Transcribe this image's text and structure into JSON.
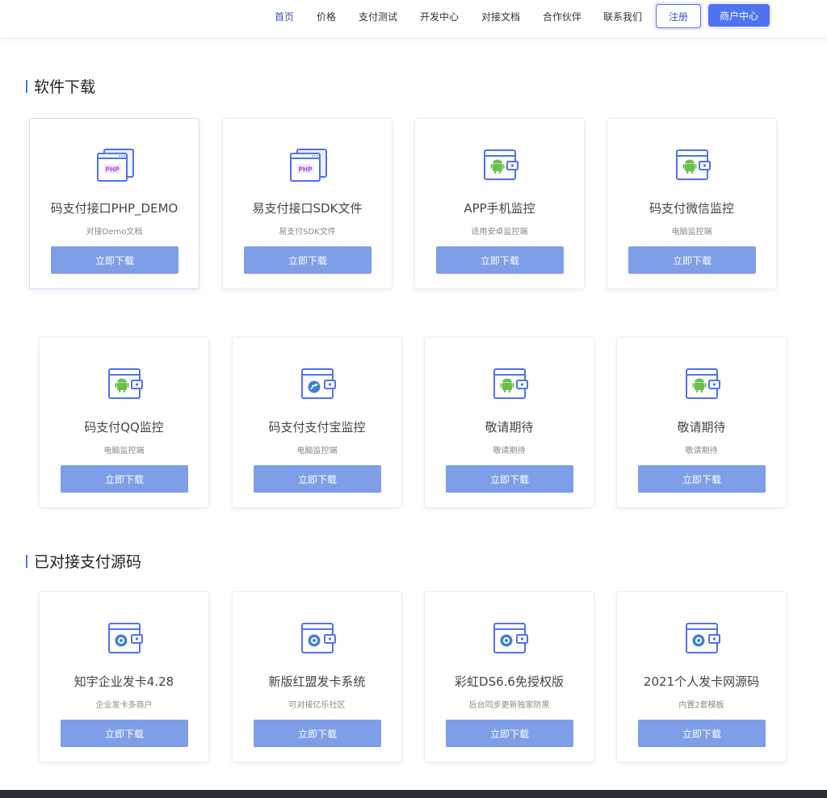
{
  "nav": {
    "items": [
      "首页",
      "价格",
      "支付测试",
      "开发中心",
      "对接文档",
      "合作伙伴",
      "联系我们"
    ],
    "register_label": "注册",
    "merchant_label": "商户中心"
  },
  "sections": [
    {
      "title": "软件下载",
      "cards": [
        {
          "title": "码支付接口PHP_DEMO",
          "subtitle": "对接Demo文档",
          "button": "立即下载",
          "icon": "php-icon"
        },
        {
          "title": "易支付接口SDK文件",
          "subtitle": "易支付SDK文件",
          "button": "立即下载",
          "icon": "php-icon"
        },
        {
          "title": "APP手机监控",
          "subtitle": "适用安卓监控端",
          "button": "立即下载",
          "icon": "android-icon"
        },
        {
          "title": "码支付微信监控",
          "subtitle": "电脑监控端",
          "button": "立即下载",
          "icon": "android-icon"
        },
        {
          "title": "码支付QQ监控",
          "subtitle": "电脑监控端",
          "button": "立即下载",
          "icon": "android-icon"
        },
        {
          "title": "码支付支付宝监控",
          "subtitle": "电脑监控端",
          "button": "立即下载",
          "icon": "alipay-icon"
        },
        {
          "title": "敬请期待",
          "subtitle": "敬请期待",
          "button": "立即下载",
          "icon": "android-icon"
        },
        {
          "title": "敬请期待",
          "subtitle": "敬请期待",
          "button": "立即下载",
          "icon": "android-icon"
        }
      ]
    },
    {
      "title": "已对接支付源码",
      "cards": [
        {
          "title": "知宇企业发卡4.28",
          "subtitle": "企业发卡多商户",
          "button": "立即下载",
          "icon": "gear-icon"
        },
        {
          "title": "新版红盟发卡系统",
          "subtitle": "可对接亿乐社区",
          "button": "立即下载",
          "icon": "gear-icon"
        },
        {
          "title": "彩虹DS6.6免授权版",
          "subtitle": "后台同步更新独家防黑",
          "button": "立即下载",
          "icon": "gear-icon"
        },
        {
          "title": "2021个人发卡网源码",
          "subtitle": "内置2套模板",
          "button": "立即下载",
          "icon": "gear-icon"
        }
      ]
    }
  ],
  "colors": {
    "accent": "#4e72f0",
    "button": "#7f9ee8",
    "android": "#6cc04a"
  }
}
